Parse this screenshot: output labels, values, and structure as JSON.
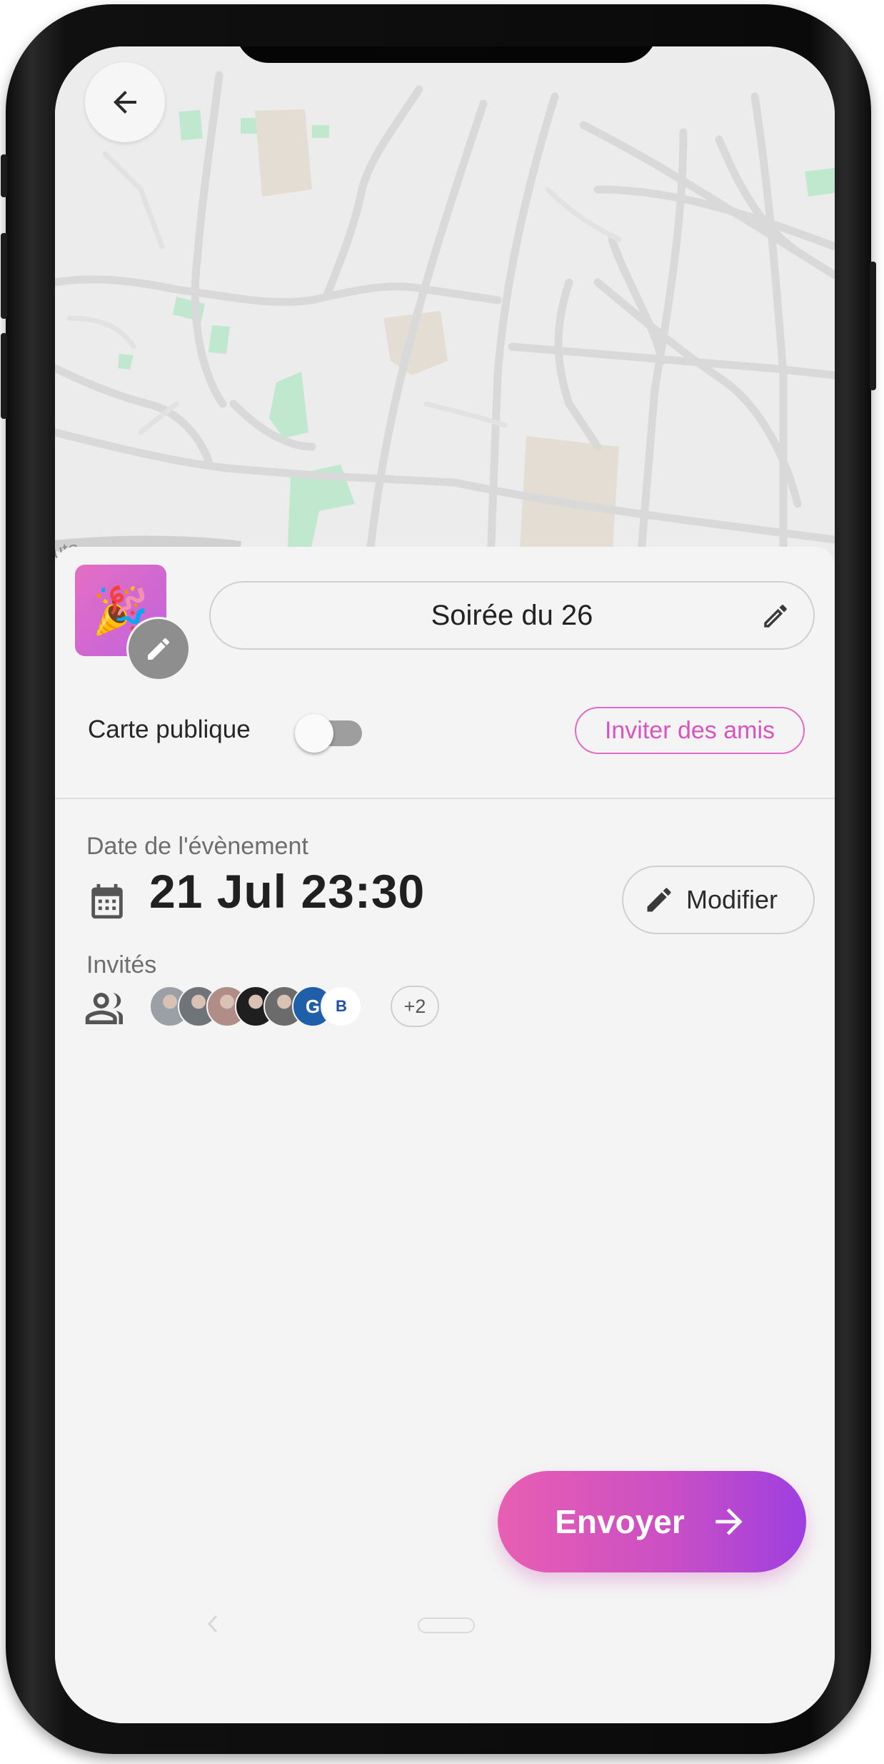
{
  "map": {
    "road_label": "uto"
  },
  "header": {
    "back_icon": "arrow-left-icon"
  },
  "event": {
    "emoji": "🎉",
    "name": "Soirée du 26",
    "icon_color_start": "#e46ec4",
    "icon_color_end": "#c063dc"
  },
  "visibility": {
    "label": "Carte publique",
    "public": false
  },
  "invite": {
    "label": "Inviter des amis",
    "accent": "#d955bd"
  },
  "date": {
    "label": "Date de l'évènement",
    "value": "21 Jul 23:30",
    "modify_label": "Modifier"
  },
  "guests": {
    "label": "Invités",
    "avatars": [
      {
        "kind": "photo",
        "color": "#9aa0a6",
        "text": ""
      },
      {
        "kind": "photo",
        "color": "#6f7478",
        "text": ""
      },
      {
        "kind": "photo",
        "color": "#b08d86",
        "text": ""
      },
      {
        "kind": "photo",
        "color": "#1f1f1f",
        "text": ""
      },
      {
        "kind": "photo",
        "color": "#6b6b6b",
        "text": ""
      },
      {
        "kind": "initial",
        "color": "#1f5ea8",
        "text": "G"
      },
      {
        "kind": "logo",
        "color": "#ffffff",
        "text": "B"
      }
    ],
    "more_label": "+2"
  },
  "actions": {
    "send_label": "Envoyer",
    "send_gradient": [
      "#e85fb2",
      "#cb4fc4",
      "#9e3fe0"
    ]
  }
}
